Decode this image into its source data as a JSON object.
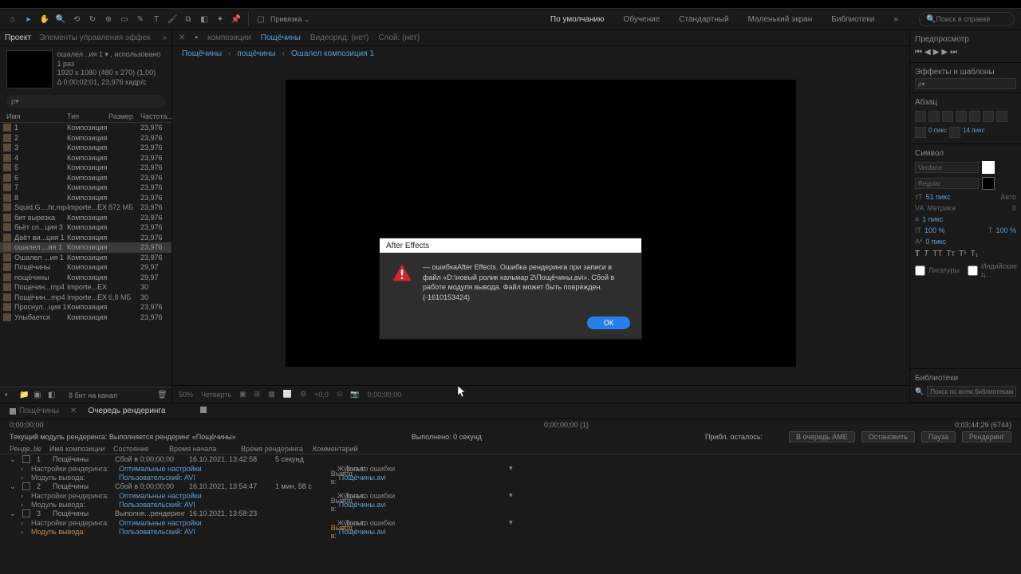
{
  "app_title": "After Effects",
  "workspace": {
    "tabs": [
      "По умолчанию",
      "Обучение",
      "Стандартный",
      "Маленький экран",
      "Библиотеки"
    ],
    "search_placeholder": "Поиск в справке"
  },
  "left_panel": {
    "tabs": [
      "Проект",
      "Элементы управления эффек"
    ],
    "header": {
      "name": "ошалел ..ия 1 ▾ , использовано 1 раз",
      "dims": "1920 x 1080  (480 x 270) (1,00)",
      "dur": "Δ 0;00;02;01, 23,976 кадр/с"
    },
    "search_placeholder": "ρ▾",
    "columns": [
      "Имя",
      "Тип",
      "Размер",
      "Частота..."
    ],
    "items": [
      {
        "name": "1",
        "type": "Композиция",
        "size": "",
        "rate": "23,976"
      },
      {
        "name": "2",
        "type": "Композиция",
        "size": "",
        "rate": "23,976"
      },
      {
        "name": "3",
        "type": "Композиция",
        "size": "",
        "rate": "23,976"
      },
      {
        "name": "4",
        "type": "Композиция",
        "size": "",
        "rate": "23,976"
      },
      {
        "name": "5",
        "type": "Композиция",
        "size": "",
        "rate": "23,976"
      },
      {
        "name": "6",
        "type": "Композиция",
        "size": "",
        "rate": "23,976"
      },
      {
        "name": "7",
        "type": "Композиция",
        "size": "",
        "rate": "23,976"
      },
      {
        "name": "8",
        "type": "Композиция",
        "size": "",
        "rate": "23,976"
      },
      {
        "name": "Squid.G....ht.mp4",
        "type": "Importe...EX",
        "size": "872 МБ",
        "rate": "23,976"
      },
      {
        "name": "бит вырезка",
        "type": "Композиция",
        "size": "",
        "rate": "23,976"
      },
      {
        "name": "бьёт сп...ция 3",
        "type": "Композиция",
        "size": "",
        "rate": "23,976"
      },
      {
        "name": "Даёт ви...ция 1",
        "type": "Композиция",
        "size": "",
        "rate": "23,976"
      },
      {
        "name": "ошалел ...ия 1",
        "type": "Композиция",
        "size": "",
        "rate": "23,976",
        "selected": true
      },
      {
        "name": "Ошалел ...ия 1",
        "type": "Композиция",
        "size": "",
        "rate": "23,976"
      },
      {
        "name": "Пощёчины",
        "type": "Композиция",
        "size": "",
        "rate": "29,97"
      },
      {
        "name": "пощёчины",
        "type": "Композиция",
        "size": "",
        "rate": "29,97"
      },
      {
        "name": "Пощечин...mp4",
        "type": "Importe...EX",
        "size": "",
        "rate": "30"
      },
      {
        "name": "Пощёчин...mp4",
        "type": "Importe...EX",
        "size": "6,8 МБ",
        "rate": "30"
      },
      {
        "name": "Проснул...ция 1",
        "type": "Композиция",
        "size": "",
        "rate": "23,976"
      },
      {
        "name": "Улыбается",
        "type": "Композиция",
        "size": "",
        "rate": "23,976"
      }
    ],
    "footer_text": "8 бит на канал"
  },
  "center": {
    "comp_tabs": {
      "prefix": "композиции",
      "active": "Пощёчины",
      "others": [
        "Видеоряд: (нет)",
        "Слой: (нет)"
      ]
    },
    "breadcrumb": [
      "Пощёчины",
      "пощёчины",
      "Ошалел композиция 1"
    ],
    "viewer_controls": {
      "zoom": "50%",
      "quality": "Четверть",
      "time": "0;00;00;00",
      "exposure": "+0,0"
    }
  },
  "right_panel": {
    "preview": {
      "title": "Предпросмотр"
    },
    "effects": {
      "title": "Эффекты и шаблоны",
      "search": "ρ▾"
    },
    "align": {
      "title": "Абзац"
    },
    "character": {
      "title": "Символ",
      "font": "Verdana",
      "weight": "Regular",
      "size": "51 пикс",
      "leading": "Авто",
      "kerning": "Метрика",
      "tracking": "0",
      "scale_v": "100 %",
      "scale_h": "100 %",
      "baseline": "0 пикс",
      "stroke": "1 пикс"
    },
    "ligature_label": "Лигатуры",
    "hindi_label": "Индийские ц...",
    "library": {
      "title": "Библиотеки",
      "search_placeholder": "Поиск по всем библиотекам"
    }
  },
  "bottom": {
    "tabs": [
      "Пощёчины",
      "Очередь рендеринга"
    ],
    "time_left": "0;00;00;00",
    "time_mid": "0;00;00;00 (1)",
    "time_right": "0;03;44;29 (6744)",
    "status": {
      "current": "Текущий модуль рендеринга:",
      "rendering": "Выполняется рендеринг «Пощёчины»",
      "done_label": "Выполнено:",
      "done_value": "0 секунд",
      "remain_label": "Прибл. осталось:",
      "remain_value": ""
    },
    "buttons": [
      "В очередь AME",
      "Остановить",
      "Пауза",
      "Рендеринг"
    ],
    "columns": [
      "Ренде...",
      "№",
      "Имя композиции",
      "Состояние",
      "Время начала",
      "Время рендеринга",
      "Комментарий"
    ],
    "queue": [
      {
        "num": "1",
        "name": "Пощёчины",
        "status": "Сбой в 0;00;00;00",
        "start": "16.10.2021, 13:42:58",
        "dur": "5 секунд",
        "settings": {
          "label": "Настройки рендеринга:",
          "value": "Оптимальные настройки",
          "log_label": "Журнал:",
          "log_value": "Только ошибки"
        },
        "output": {
          "label": "Модуль вывода:",
          "value": "Пользовательский: AVI",
          "out_label": "Вывод в:",
          "out_value": "Пощёчины.avi"
        }
      },
      {
        "num": "2",
        "name": "Пощёчины",
        "status": "Сбой в 0;00;00;00",
        "start": "16.10.2021, 13:54:47",
        "dur": "1 мин, 58 с",
        "settings": {
          "label": "Настройки рендеринга:",
          "value": "Оптимальные настройки",
          "log_label": "Журнал:",
          "log_value": "Только ошибки"
        },
        "output": {
          "label": "Модуль вывода:",
          "value": "Пользовательский: AVI",
          "out_label": "Вывод в:",
          "out_value": "Пощёчины.avi"
        }
      },
      {
        "num": "3",
        "name": "Пощёчины",
        "status": "Выполня...рендеринг",
        "start": "16.10.2021, 13:58:23",
        "dur": "",
        "settings": {
          "label": "Настройки рендеринга:",
          "value": "Оптимальные настройки",
          "log_label": "Журнал:",
          "log_value": "Только ошибки"
        },
        "output": {
          "label": "Модуль вывода:",
          "value": "Пользовательский: AVI",
          "out_label": "Вывод в:",
          "out_value": "Пощёчины.avi",
          "highlight": true
        }
      }
    ]
  },
  "modal": {
    "title": "After Effects",
    "text": "— ошибкаAfter Effects. Ошибка рендеринга при записи в файл «D:\\новый ролик кальмар 2\\Пощёчины.avi». Сбой в работе модуля вывода. Файл может быть поврежден. (-1610153424)",
    "ok": "ОК"
  }
}
